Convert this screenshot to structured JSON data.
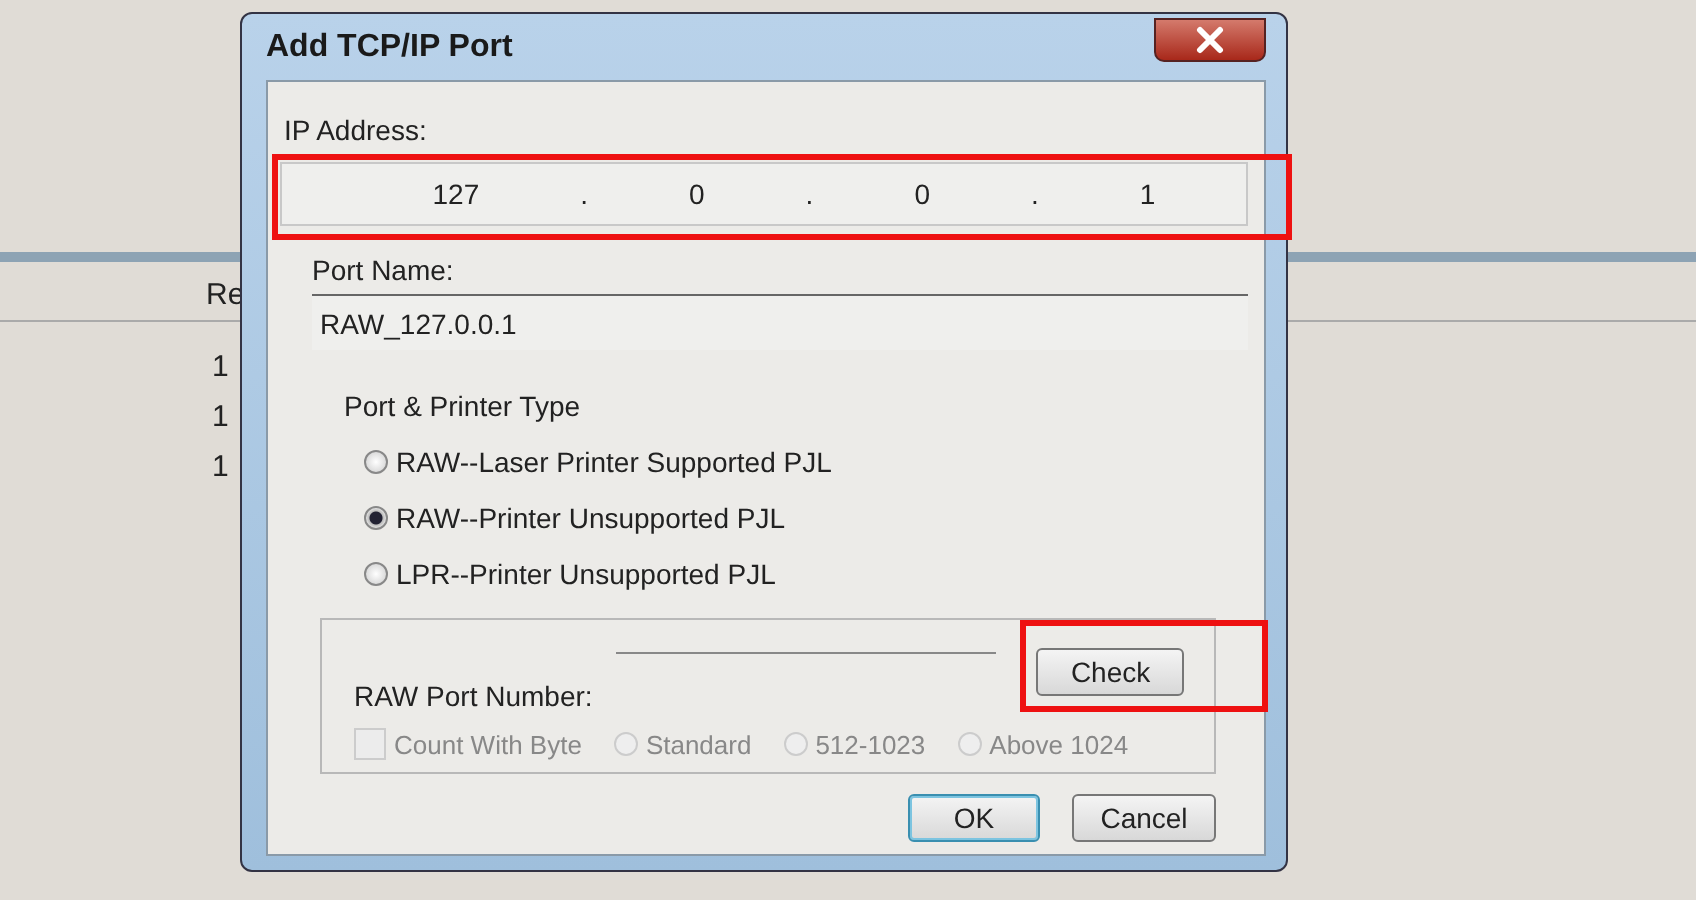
{
  "background_table": {
    "header": "Re",
    "rows": [
      "1",
      "1",
      "1"
    ]
  },
  "window": {
    "title": "Add TCP/IP Port"
  },
  "ip_address": {
    "label": "IP Address:",
    "octets": [
      "127",
      "0",
      "0",
      "1"
    ],
    "separators": [
      ".",
      ".",
      "."
    ],
    "highlighted": true
  },
  "port_name": {
    "label": "Port Name:",
    "value": "RAW_127.0.0.1"
  },
  "port_type": {
    "label": "Port & Printer Type",
    "options": [
      {
        "label": "RAW--Laser Printer Supported PJL",
        "selected": false
      },
      {
        "label": "RAW--Printer Unsupported PJL",
        "selected": true
      },
      {
        "label": "LPR--Printer Unsupported PJL",
        "selected": false
      }
    ]
  },
  "raw_port": {
    "label": "RAW Port Number:",
    "check_button": {
      "label": "Check",
      "highlighted": true
    },
    "count_with_byte": {
      "label": "Count With Byte",
      "checked": false,
      "disabled": true
    },
    "ranges": [
      {
        "label": "Standard",
        "selected": false,
        "disabled": true
      },
      {
        "label": "512-1023",
        "selected": false,
        "disabled": true
      },
      {
        "label": "Above 1024",
        "selected": false,
        "disabled": true
      }
    ]
  },
  "buttons": [
    {
      "label": "OK",
      "default": true
    },
    {
      "label": "Cancel",
      "default": false
    }
  ]
}
